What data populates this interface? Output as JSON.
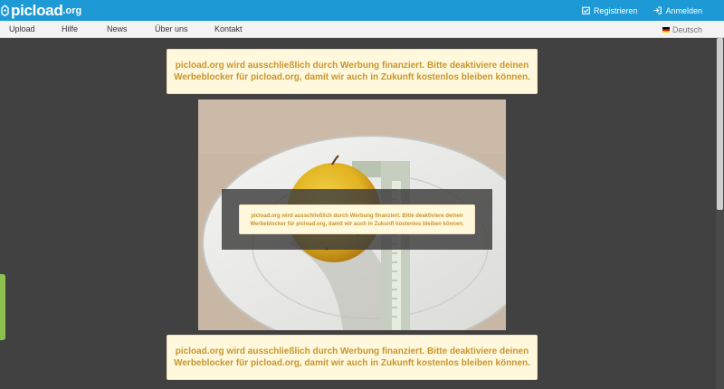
{
  "header": {
    "logo_text": "picload",
    "logo_suffix": ".org",
    "register_label": "Registrieren",
    "login_label": "Anmelden"
  },
  "nav": {
    "items": [
      "Upload",
      "Hilfe",
      "News",
      "Über uns",
      "Kontakt"
    ],
    "language": "Deutsch"
  },
  "notices": {
    "top_line1": "picload.org wird ausschließlich durch Werbung finanziert. Bitte deaktiviere deinen",
    "top_line2": "Werbeblocker für picload.org, damit wir auch in Zukunft kostenlos bleiben können.",
    "mid_line1": "picload.org wird ausschließlich durch Werbung finanziert. Bitte deaktiviere deinen",
    "mid_line2": "Werbeblocker für picload.org, damit wir auch in Zukunft kostenlos bleiben können.",
    "bottom_line1": "picload.org wird ausschließlich durch Werbung finanziert. Bitte deaktiviere deinen",
    "bottom_line2": "Werbeblocker für picload.org, damit wir auch in Zukunft kostenlos bleiben können."
  },
  "colors": {
    "header_bg": "#1d9ad6",
    "page_bg": "#414141",
    "notice_bg": "#fff8dc",
    "notice_text": "#c8962f",
    "accent_green": "#8cc152"
  },
  "icons": {
    "register": "clipboard-check-icon",
    "login": "login-icon",
    "logo": "cloud-logo-icon",
    "language": "german-flag-icon"
  }
}
